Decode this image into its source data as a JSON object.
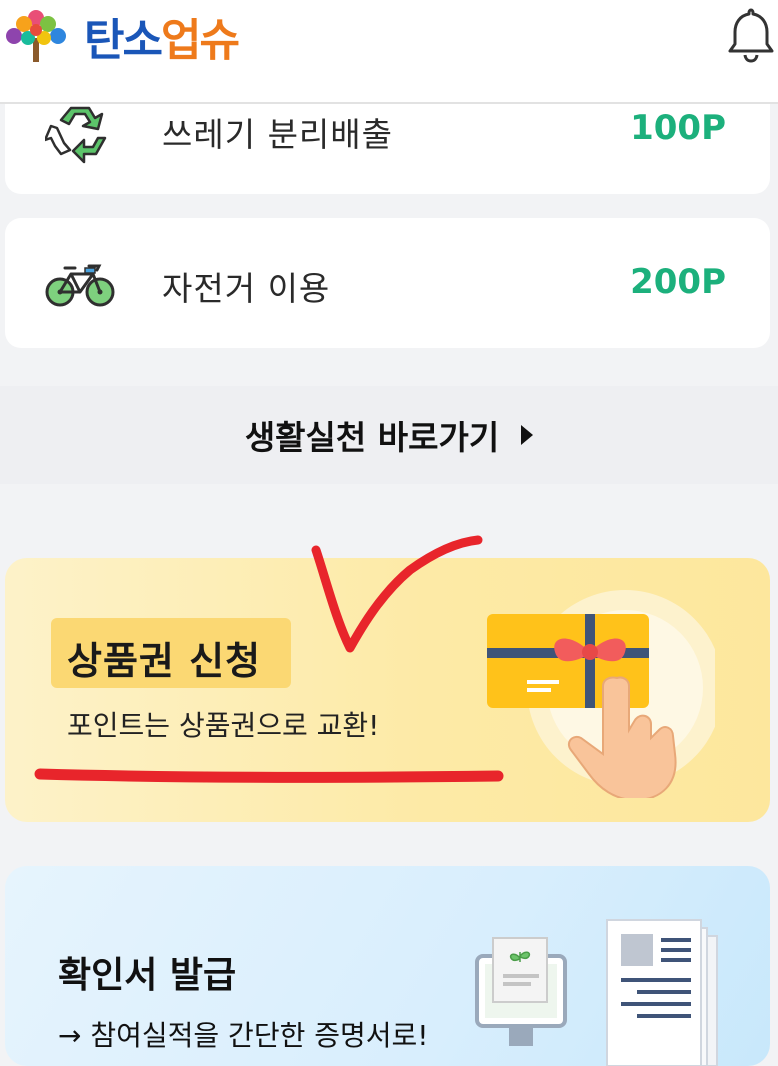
{
  "header": {
    "logo_part1": "탄소",
    "logo_part2": "업슈",
    "bell_icon": "bell-icon"
  },
  "activities": [
    {
      "icon": "recycle-icon",
      "label": "쓰레기 분리배출",
      "points": "100P"
    },
    {
      "icon": "bicycle-icon",
      "label": "자전거 이용",
      "points": "200P"
    }
  ],
  "shortcut": {
    "label": "생활실천 바로가기",
    "icon": "triangle-right-icon"
  },
  "voucher": {
    "title": "상품권 신청",
    "subtitle": "포인트는 상품권으로 교환!",
    "icon": "gift-card-icon"
  },
  "certificate": {
    "title": "확인서 발급",
    "subtitle": "→ 참여실적을 간단한 증명서로!",
    "icon": "document-icon"
  },
  "colors": {
    "brand_blue": "#1a56b8",
    "brand_orange": "#ee7a1b",
    "points_green": "#1cb07c",
    "voucher_bg": "#fdeaa6",
    "cert_bg": "#d8eefd",
    "annotation_red": "#e8252b"
  }
}
